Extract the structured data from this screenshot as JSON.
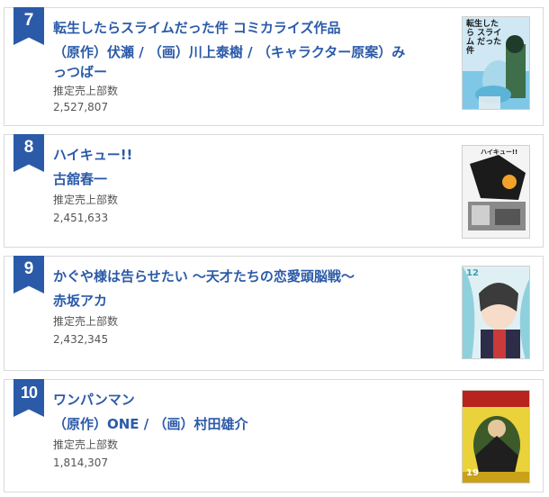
{
  "sales_label": "推定売上部数",
  "rankings": [
    {
      "rank": "7",
      "title": "転生したらスライムだった件 コミカライズ作品",
      "author_line1": "（原作）伏瀬 / （画）川上泰樹 / （キャラクター原案）み",
      "author_line2": "っつばー",
      "sales": "2,527,807",
      "cover_lettering": "転生したら スライム だった件"
    },
    {
      "rank": "8",
      "title": "ハイキュー!!",
      "author_line1": "古舘春一",
      "sales": "2,451,633",
      "cover_lettering": "ハイキュー!!"
    },
    {
      "rank": "9",
      "title": "かぐや様は告らせたい ～天才たちの恋愛頭脳戦～",
      "author_line1": "赤坂アカ",
      "sales": "2,432,345",
      "cover_lettering": "12"
    },
    {
      "rank": "10",
      "title": "ワンパンマン",
      "author_line1": "（原作）ONE / （画）村田雄介",
      "sales": "1,814,307",
      "cover_lettering": "19"
    }
  ]
}
